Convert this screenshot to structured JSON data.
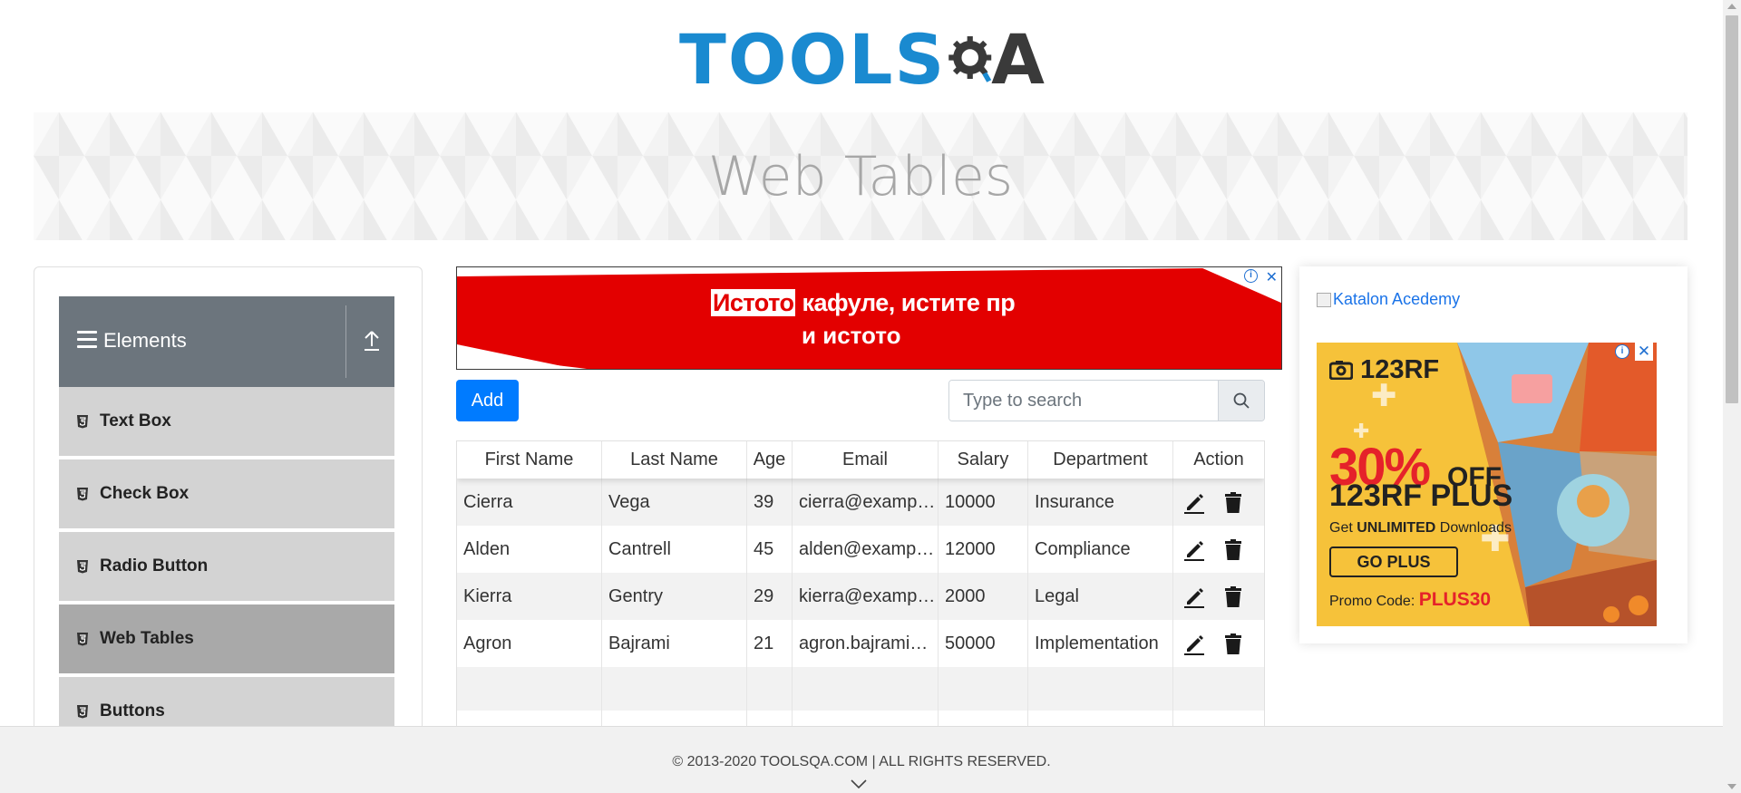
{
  "header": {
    "logo_text_tools": "TOOLS",
    "logo_text_a": "A",
    "logo_alt": "TOOLSQA"
  },
  "banner": {
    "title": "Web Tables"
  },
  "sidebar": {
    "group_title": "Elements",
    "items": [
      {
        "label": "Text Box",
        "active": false
      },
      {
        "label": "Check Box",
        "active": false
      },
      {
        "label": "Radio Button",
        "active": false
      },
      {
        "label": "Web Tables",
        "active": true
      },
      {
        "label": "Buttons",
        "active": false
      }
    ]
  },
  "ad_top": {
    "line1_highlight": "Истото",
    "line1_rest": " кафуле, истите пријате",
    "line2": "и истото",
    "info_icon": "i",
    "close_icon": "✕"
  },
  "toolbar": {
    "add_label": "Add"
  },
  "search": {
    "placeholder": "Type to search"
  },
  "table": {
    "columns": [
      "First Name",
      "Last Name",
      "Age",
      "Email",
      "Salary",
      "Department",
      "Action"
    ],
    "rows": [
      [
        "Cierra",
        "Vega",
        "39",
        "cierra@example.com",
        "10000",
        "Insurance"
      ],
      [
        "Alden",
        "Cantrell",
        "45",
        "alden@example.com",
        "12000",
        "Compliance"
      ],
      [
        "Kierra",
        "Gentry",
        "29",
        "kierra@example.com",
        "2000",
        "Legal"
      ],
      [
        "Agron",
        "Bajrami",
        "21",
        "agron.bajrami@example.com",
        "50000",
        "Implementation"
      ]
    ]
  },
  "ad_right": {
    "broken_image_alt": "Katalon Acedemy",
    "brand": "123RF",
    "percent": "30%",
    "off": "OFF",
    "product": "123RF PLUS",
    "tagline_prefix": "Get ",
    "tagline_bold": "UNLIMITED",
    "tagline_suffix": " Downloads",
    "button": "GO PLUS",
    "promo_prefix": "Promo Code: ",
    "promo_code": "PLUS30",
    "info_icon": "i",
    "close_icon": "✕"
  },
  "footer": {
    "copyright": "© 2013-2020 TOOLSQA.COM | ALL RIGHTS RESERVED."
  },
  "colors": {
    "primary": "#007bff",
    "sidebar_header": "#6c757d",
    "menu_item": "#d3d3d3",
    "menu_active": "#a9a9a9",
    "logo_blue": "#1a8ad0",
    "ad_red": "#e30000"
  },
  "icons": {
    "menu": "hamburger-icon",
    "collapse": "upload-arrow-icon",
    "item": "html5-icon",
    "search": "magnifier-icon",
    "edit": "pencil-icon",
    "delete": "trash-icon",
    "footer": "chevron-down-icon"
  }
}
